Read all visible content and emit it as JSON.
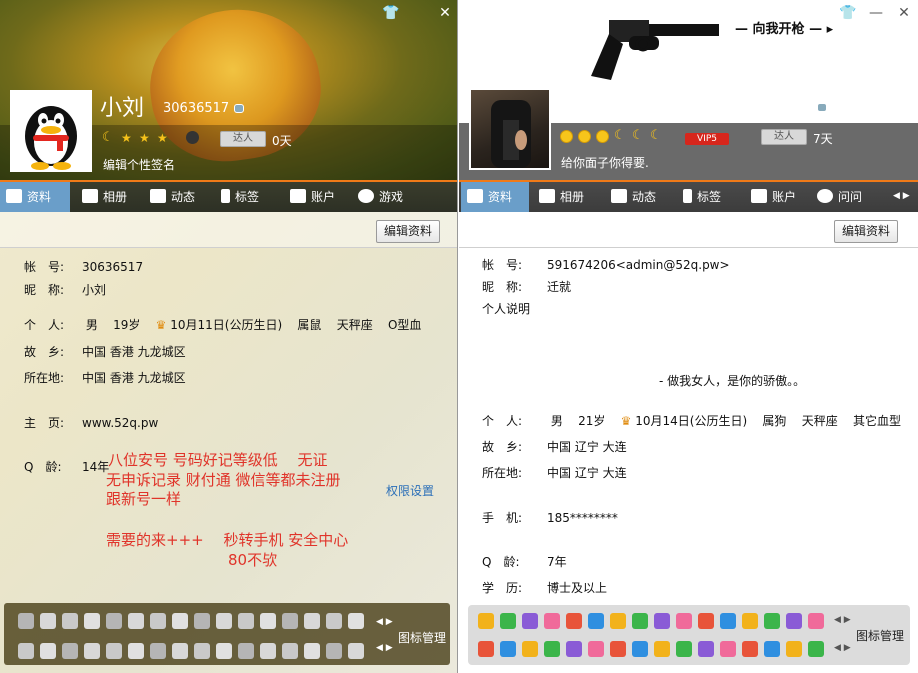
{
  "left": {
    "nickname": "小刘",
    "qq_number": "30636517",
    "signature": "编辑个性签名",
    "daren_label": "达人",
    "daren_days": "0天",
    "tabs": [
      "资料",
      "相册",
      "动态",
      "标签",
      "账户",
      "游戏"
    ],
    "edit_button": "编辑资料",
    "fields": {
      "account": {
        "label": "帐　号:",
        "value": "30636517"
      },
      "nickname": {
        "label": "昵　称:",
        "value": "小刘"
      },
      "personal": {
        "label": "个　人:",
        "gender": "男",
        "age": "19岁",
        "birthday": "10月11日(公历生日)",
        "zodiac": "属鼠",
        "constellation": "天秤座",
        "blood": "O型血"
      },
      "hometown": {
        "label": "故　乡:",
        "value": "中国 香港 九龙城区"
      },
      "location": {
        "label": "所在地:",
        "value": "中国 香港 九龙城区"
      },
      "homepage": {
        "label": "主　页:",
        "value": "www.52q.pw"
      },
      "qage": {
        "label": "Q　龄:",
        "value": "14年"
      }
    },
    "note_lines": [
      "八位安号 号码好记等级低　 无证",
      "无申诉记录 财付通 微信等都未注册",
      "跟新号一样",
      "需要的来+++　 秒转手机 安全中心",
      "80不欤"
    ],
    "permission_link": "权限设置",
    "icon_manage": "图标管理"
  },
  "right": {
    "banner_text": "向我开枪",
    "nickname": "迁就",
    "qq_number": "591674206<admin@52q.pw>",
    "signature": "给你面子你得要.",
    "vip_label": "VIP5",
    "daren_label": "达人",
    "daren_days": "7天",
    "tabs": [
      "资料",
      "相册",
      "动态",
      "标签",
      "账户",
      "问问"
    ],
    "edit_button": "编辑资料",
    "fields": {
      "account": {
        "label": "帐　号:",
        "value": "591674206<admin@52q.pw>"
      },
      "nickname": {
        "label": "昵　称:",
        "value": "迁就"
      },
      "description_label": "个人说明",
      "description": "- 做我女人，是你的骄傲。。",
      "personal": {
        "label": "个　人:",
        "gender": "男",
        "age": "21岁",
        "birthday": "10月14日(公历生日)",
        "zodiac": "属狗",
        "constellation": "天秤座",
        "blood": "其它血型"
      },
      "hometown": {
        "label": "故　乡:",
        "value": "中国 辽宁 大连"
      },
      "location": {
        "label": "所在地:",
        "value": "中国 辽宁 大连"
      },
      "phone": {
        "label": "手　机:",
        "value": "185********"
      },
      "qage": {
        "label": "Q　龄:",
        "value": "7年"
      },
      "education": {
        "label": "学　历:",
        "value": "博士及以上"
      }
    },
    "icon_manage": "图标管理"
  },
  "colors": {
    "accent_orange": "#f07a18",
    "active_tab": "#6a9ec9",
    "note_red": "#e0342a",
    "link_blue": "#2b6fb8"
  }
}
